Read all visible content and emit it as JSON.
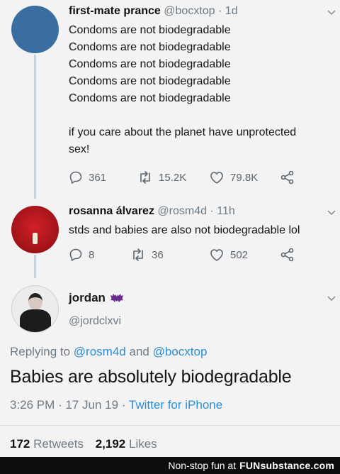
{
  "tweets": [
    {
      "name": "first-mate prance",
      "handle": "@bocxtop",
      "time": "1d",
      "lines": [
        "Condoms are not biodegradable",
        "Condoms are not biodegradable",
        "Condoms are not biodegradable",
        "Condoms are not biodegradable",
        "Condoms are not biodegradable",
        "",
        "if you care about the planet have unprotected",
        "sex!"
      ],
      "replies": "361",
      "retweets": "15.2K",
      "likes": "79.8K",
      "avatar_color": "#3b6ea0"
    },
    {
      "name": "rosanna álvarez",
      "handle": "@rosm4d",
      "time": "11h",
      "lines": [
        "stds and babies are also not biodegradable lol"
      ],
      "replies": "8",
      "retweets": "36",
      "likes": "502",
      "avatar_color": "#b3171b"
    }
  ],
  "main": {
    "name": "jordan",
    "handle": "@jordclxvi",
    "replying_prefix": "Replying to",
    "replying_user1": "@rosm4d",
    "replying_and": "and",
    "replying_user2": "@bocxtop",
    "text": "Babies are absolutely biodegradable",
    "timestamp": "3:26 PM · 17 Jun 19 ·",
    "source": "Twitter for iPhone",
    "retweet_count": "172",
    "retweet_label": "Retweets",
    "like_count": "2,192",
    "like_label": "Likes"
  },
  "footer": {
    "prefix": "Non-stop fun at",
    "brand": "FUNsubstance.com"
  },
  "colors": {
    "link": "#2b8fd6",
    "muted": "#6e7b86"
  }
}
